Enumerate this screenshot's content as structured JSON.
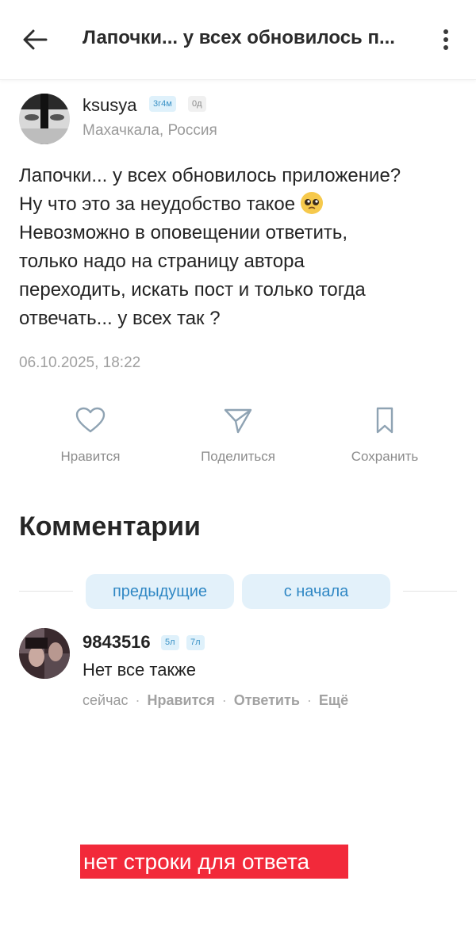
{
  "header": {
    "title": "Лапочки... у всех обновилось п...",
    "back_icon": "arrow-left-icon",
    "more_icon": "more-vertical-icon"
  },
  "post": {
    "author": {
      "name": "ksusya",
      "badge_age": "3г4м",
      "badge_time": "0д",
      "location": "Махачкала, Россия"
    },
    "text_before_emoji": "Лапочки... у всех обновилось приложение?\nНу что это за неудобство такое ",
    "emoji_icon": "pleading-face-emoji",
    "text_after_emoji": "\nНевозможно в оповещении ответить,\nтолько надо на страницу автора\nпереходить,  искать пост и только тогда\nотвечать... у всех так ?",
    "date": "06.10.2025, 18:22"
  },
  "actions": [
    {
      "label": "Нравится",
      "icon": "heart-icon"
    },
    {
      "label": "Поделиться",
      "icon": "send-icon"
    },
    {
      "label": "Сохранить",
      "icon": "bookmark-icon"
    }
  ],
  "comments": {
    "heading": "Комментарии",
    "prev_button": "предыдущие",
    "from_start_button": "с начала",
    "items": [
      {
        "author": "9843516",
        "badge_1": "5л",
        "badge_2": "7л",
        "text": "Нет все также",
        "time": "сейчас",
        "like": "Нравится",
        "reply": "Ответить",
        "more": "Ещё"
      }
    ]
  },
  "annotation": {
    "text": "нет строки для ответа",
    "color": "#f2293a"
  },
  "colors": {
    "accent": "#2f87c4",
    "pill_bg": "#e3f1fa",
    "muted_text": "#9a9a9a"
  }
}
